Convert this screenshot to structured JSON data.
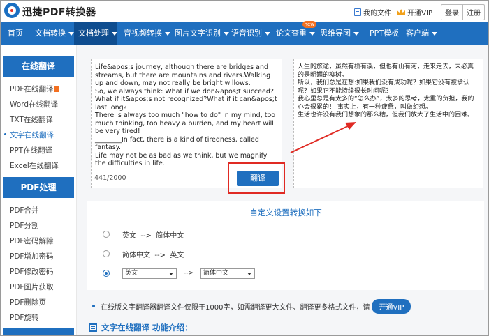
{
  "header": {
    "brand": "迅捷PDF转换器",
    "my_files": "我的文件",
    "open_vip": "开通VIP",
    "login": "登录",
    "register": "注册"
  },
  "nav": {
    "items": [
      {
        "label": "首页",
        "dropdown": false
      },
      {
        "label": "文档转换",
        "dropdown": true
      },
      {
        "label": "文档处理",
        "dropdown": true,
        "active": true
      },
      {
        "label": "音视频转换",
        "dropdown": true
      },
      {
        "label": "图片文字识别",
        "dropdown": true
      },
      {
        "label": "语音识别",
        "dropdown": true
      },
      {
        "label": "论文查重",
        "dropdown": true,
        "badge": "new"
      },
      {
        "label": "思维导图",
        "dropdown": true
      },
      {
        "label": "PPT模板",
        "dropdown": false
      },
      {
        "label": "客户端",
        "dropdown": true
      }
    ]
  },
  "sidebar": {
    "section1_title": "在线翻译",
    "section1_items": [
      "PDF在线翻译",
      "Word在线翻译",
      "TXT在线翻译",
      "文字在线翻译",
      "PPT在线翻译",
      "Excel在线翻译"
    ],
    "section2_title": "PDF处理",
    "section2_items": [
      "PDF合并",
      "PDF分割",
      "PDF密码解除",
      "PDF增加密码",
      "PDF修改密码",
      "PDF图片获取",
      "PDF删除页",
      "PDF旋转"
    ]
  },
  "translator": {
    "source_text": "Life&apos;s journey, although there are bridges and streams, but there are mountains and rivers.Walking up and down, may not really be bright willows.\nSo, we always think: What if we don&apos;t succeed?What if it&apos;s not recognized?What if it can&apos;t last long?\nThere is always too much \"how to do\" in my mind, too much thinking, too heavy a burden, and my heart will be very tired!\n________In fact, there is a kind of tiredness, called fantasy.\nLife may not be as bad as we think, but we magnify the difficulties in life.",
    "char_count": "441/2000",
    "translate_button": "翻译",
    "result_text": "人生的旅途，虽然有桥有溪，但也有山有河，走来走去，未必真的是明媚的柳树。\n所以，我们总是在想:如果我们没有成功呢？如果它没有被承认呢？如果它不能持续很长时间呢？\n我心里总是有太多的“怎么办”，太多的思考，太重的负担，我的心会很累的！ 事实上，有一种疲惫，叫做幻想。\n生活也许没有我们想象的那么糟，但我们放大了生活中的困难。"
  },
  "settings": {
    "title": "自定义设置转换如下",
    "option1": "英文  -->  简体中文",
    "option2": "简体中文  -->  英文",
    "from_select": "英文",
    "arrow": "-->",
    "to_select": "简体中文",
    "selected_option": 3
  },
  "notice": {
    "text": "在线版文字翻译器翻译文件仅限于1000字，如需翻译更大文件、翻译更多格式文件，请",
    "vip_button": "开通VIP"
  },
  "intro": {
    "title": "文字在线翻译 功能介绍："
  },
  "colors": {
    "primary": "#1f6fbf",
    "nav_active": "#0f4d8f",
    "highlight_red": "#e02a23",
    "badge_orange": "#f37021"
  }
}
